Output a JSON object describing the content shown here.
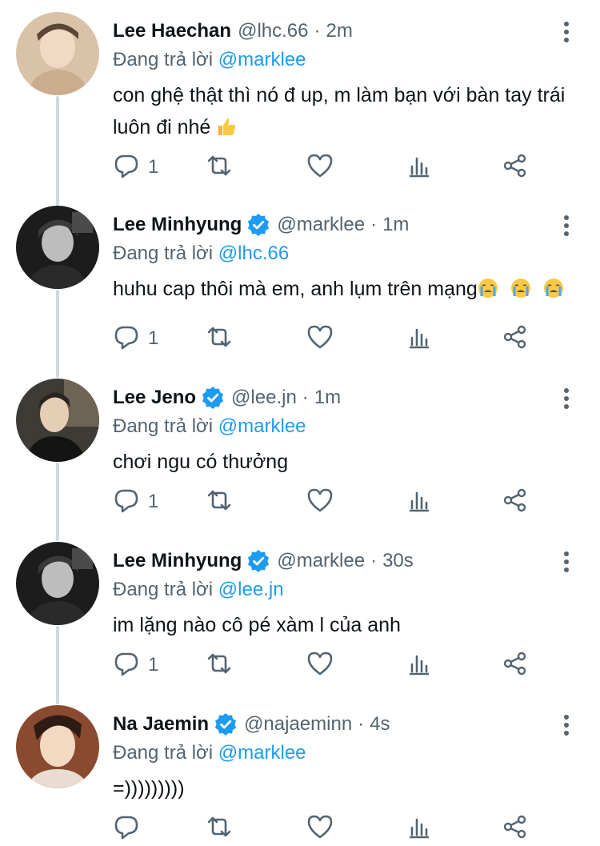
{
  "reply_prefix": "Đang trả lời",
  "tweets": [
    {
      "name": "Lee Haechan",
      "handle": "@lhc.66",
      "time": "2m",
      "verified": false,
      "reply_to": "@marklee",
      "text": "con ghệ thật thì nó đ up, m làm bạn với bàn tay trái luôn đi nhé",
      "emoji": "thumbs-up",
      "reply_count": "1"
    },
    {
      "name": "Lee Minhyung",
      "handle": "@marklee",
      "time": "1m",
      "verified": true,
      "reply_to": "@lhc.66",
      "text": "huhu cap thôi mà em, anh lụm trên mạng",
      "emoji": "crying-face x3",
      "reply_count": "1"
    },
    {
      "name": "Lee Jeno",
      "handle": "@lee.jn",
      "time": "1m",
      "verified": true,
      "reply_to": "@marklee",
      "text": "chơi ngu có thưởng",
      "reply_count": "1"
    },
    {
      "name": "Lee Minhyung",
      "handle": "@marklee",
      "time": "30s",
      "verified": true,
      "reply_to": "@lee.jn",
      "text": "im lặng nào cô pé xàm l của anh",
      "reply_count": "1"
    },
    {
      "name": "Na Jaemin",
      "handle": "@najaeminn",
      "time": "4s",
      "verified": true,
      "reply_to": "@marklee",
      "text": "=)))))))))",
      "reply_count": ""
    }
  ],
  "colors": {
    "accent": "#1d9bf0",
    "secondary": "#536471",
    "text": "#0f1419",
    "thread_line": "#cfd9de"
  }
}
